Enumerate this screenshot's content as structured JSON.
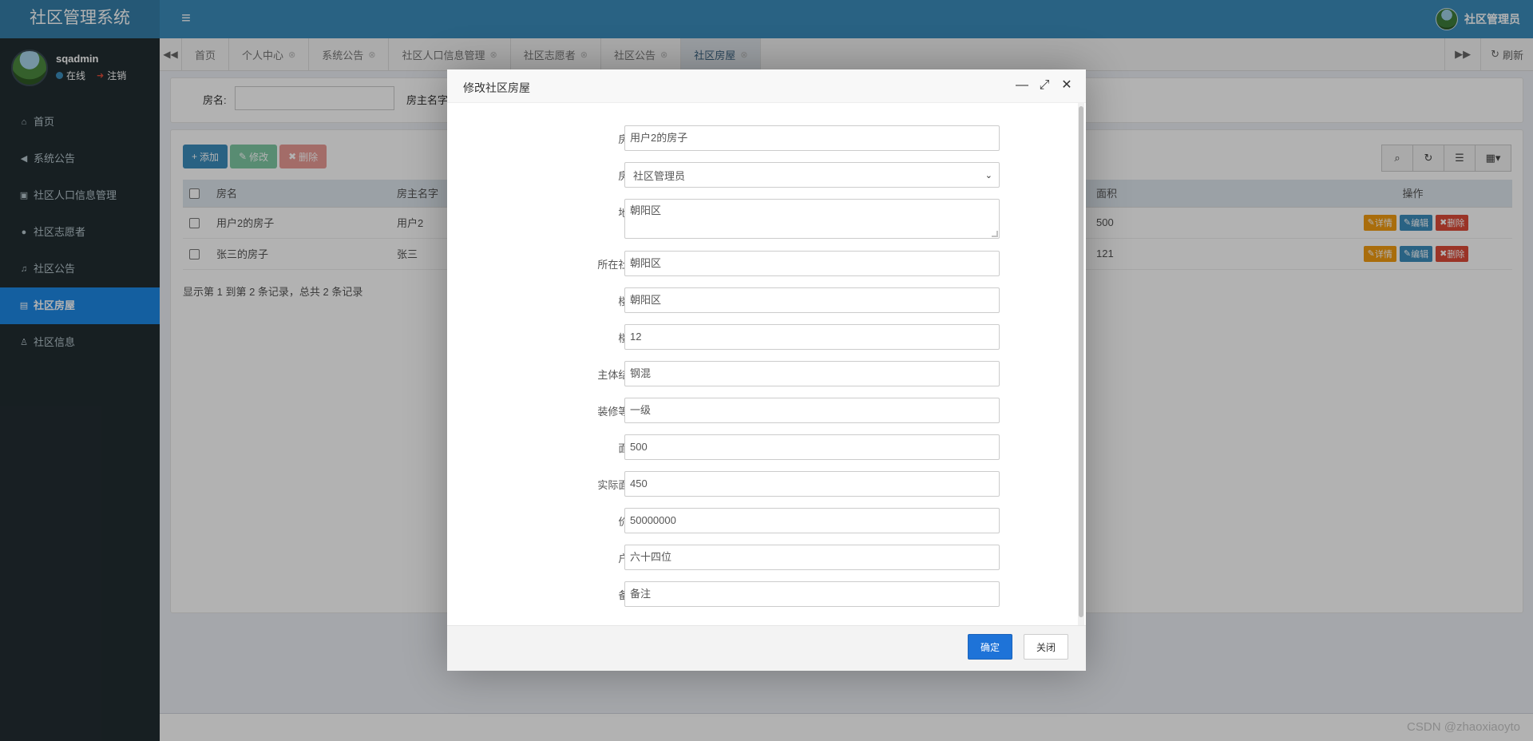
{
  "app": {
    "title": "社区管理系统",
    "menu_toggle_icon": "≡",
    "top_user": "社区管理员"
  },
  "sidebar": {
    "user_name": "sqadmin",
    "status_online": "在线",
    "logout": "注销",
    "items": [
      {
        "label": "首页",
        "icon": "home-icon"
      },
      {
        "label": "系统公告",
        "icon": "bullhorn-icon"
      },
      {
        "label": "社区人口信息管理",
        "icon": "id-card-icon"
      },
      {
        "label": "社区志愿者",
        "icon": "user-icon"
      },
      {
        "label": "社区公告",
        "icon": "bell-icon"
      },
      {
        "label": "社区房屋",
        "icon": "bed-icon",
        "active": true
      },
      {
        "label": "社区信息",
        "icon": "walk-icon"
      }
    ]
  },
  "tabs": {
    "items": [
      "首页",
      "个人中心",
      "系统公告",
      "社区人口信息管理",
      "社区志愿者",
      "社区公告",
      "社区房屋"
    ],
    "refresh": "刷新"
  },
  "search": {
    "label_house_name": "房名:",
    "label_owner_name": "房主名字"
  },
  "toolbar": {
    "add": "添加",
    "edit": "修改",
    "delete": "删除"
  },
  "table": {
    "columns": [
      "房名",
      "房主名字",
      "面积",
      "操作"
    ],
    "rows": [
      {
        "name": "用户2的房子",
        "owner": "用户2",
        "area": "500"
      },
      {
        "name": "张三的房子",
        "owner": "张三",
        "area": "121"
      }
    ],
    "actions": {
      "detail": "详情",
      "edit": "编辑",
      "delete": "删除"
    },
    "pager": "显示第 1 到第 2 条记录，总共 2 条记录"
  },
  "dialog": {
    "title": "修改社区房屋",
    "fields": {
      "name": {
        "label": "房名:",
        "value": "用户2的房子"
      },
      "owner": {
        "label": "房主:",
        "value": "社区管理员"
      },
      "address": {
        "label": "地址:",
        "value": "朝阳区"
      },
      "community": {
        "label": "所在社区:",
        "value": "朝阳区"
      },
      "building": {
        "label": "楼栋:",
        "value": "朝阳区"
      },
      "floor": {
        "label": "楼层:",
        "value": "12"
      },
      "structure": {
        "label": "主体结构:",
        "value": "钢混"
      },
      "decoration": {
        "label": "装修等级:",
        "value": "一级"
      },
      "area": {
        "label": "面积:",
        "value": "500"
      },
      "actual_area": {
        "label": "实际面积:",
        "value": "450"
      },
      "price": {
        "label": "价格:",
        "value": "50000000"
      },
      "layout": {
        "label": "户型:",
        "value": "六十四位"
      },
      "remark": {
        "label": "备注:",
        "value": "备注"
      }
    },
    "ok": "确定",
    "close": "关闭"
  },
  "footer": {
    "watermark": "CSDN @zhaoxiaoyto"
  },
  "colors": {
    "header": "#3c8dbc",
    "sidebar": "#222d32",
    "active_nav": "#1e88e5",
    "primary": "#3c8dbc",
    "danger": "#dd4b39",
    "warning": "#f39c12"
  }
}
